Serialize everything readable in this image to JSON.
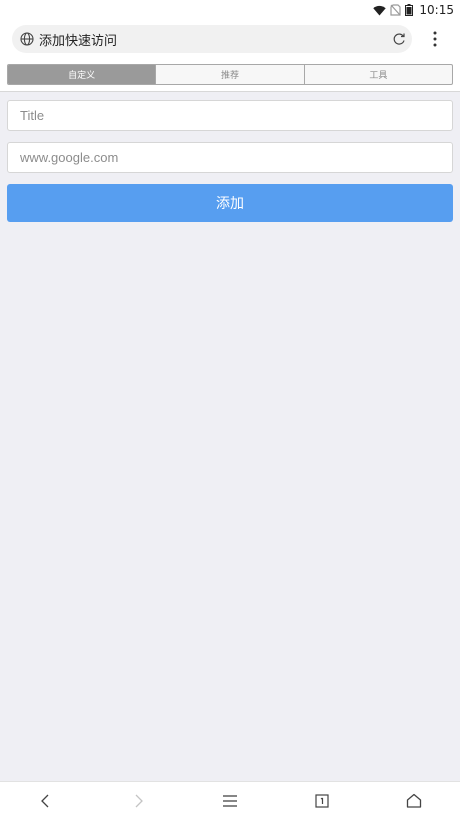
{
  "status_bar": {
    "time": "10:15"
  },
  "address_bar": {
    "title": "添加快速访问"
  },
  "tabs": [
    {
      "label": "自定义",
      "active": true
    },
    {
      "label": "推荐",
      "active": false
    },
    {
      "label": "工具",
      "active": false
    }
  ],
  "form": {
    "title_placeholder": "Title",
    "url_placeholder": "www.google.com",
    "add_label": "添加"
  },
  "colors": {
    "accent": "#579ef0",
    "background": "#efeff4",
    "active_tab": "#9a9a9a"
  },
  "icons": {
    "address": [
      "globe-icon",
      "reload-icon",
      "more-vertical-icon"
    ],
    "status": [
      "wifi-icon",
      "no-sim-icon",
      "battery-icon"
    ],
    "bottom_nav": [
      "back-icon",
      "forward-icon",
      "menu-icon",
      "tabs-icon",
      "home-icon"
    ]
  }
}
